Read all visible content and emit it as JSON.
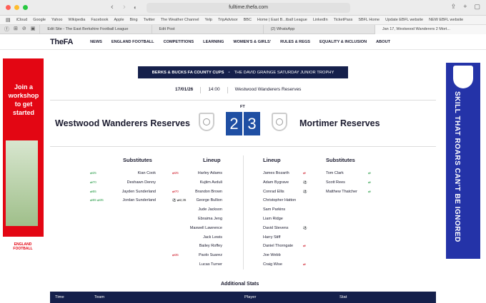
{
  "browser": {
    "url": "fulltime.thefa.com",
    "bookmarks": [
      "iCloud",
      "Google",
      "Yahoo",
      "Wikipedia",
      "Facebook",
      "Apple",
      "Bing",
      "Twitter",
      "The Weather Channel",
      "Yelp",
      "TripAdvisor",
      "BBC",
      "Home | East B...tball League",
      "LinkedIn",
      "TicketPass",
      "SBFL Home",
      "Update EBFL website",
      "NEW EBFL website"
    ],
    "tabs": [
      "Edit Site - The East Berkshire Football League",
      "Edit Post",
      "(2) WhatsApp",
      "Jan 17, Westwood Wanderers 2 Mort..."
    ]
  },
  "fa": {
    "logo": "TheFA",
    "nav": [
      "NEWS",
      "ENGLAND FOOTBALL",
      "COMPETITIONS",
      "LEARNING",
      "WOMEN'S & GIRLS'",
      "RULES & REGS",
      "EQUALITY & INCLUSION",
      "ABOUT"
    ]
  },
  "ads": {
    "left_text": "Join a workshop to get started",
    "left_logo": "ENGLAND FOOTBALL",
    "right_text": "SKILL THAT ROARS CAN'T BE IGNORED"
  },
  "match": {
    "competition": "BERKS & BUCKS FA COUNTY CUPS",
    "trophy": "THE DAVID GRAINGE SATURDAY JUNIOR TROPHY",
    "date": "17/01/26",
    "time": "14:00",
    "venue": "Westwood Wanderers Reserves",
    "status": "FT",
    "home_team": "Westwood Wanderers Reserves",
    "away_team": "Mortimer Reserves",
    "home_score": "2",
    "away_score": "3"
  },
  "headers": {
    "home_subs": "Substitutes",
    "home_lineup": "Lineup",
    "away_lineup": "Lineup",
    "away_subs": "Substitutes"
  },
  "home_subs": [
    {
      "name": "Kian Cook",
      "events": "⇄25"
    },
    {
      "name": "Deshawn Denny",
      "events": "⇄70"
    },
    {
      "name": "Jayden Sunderland",
      "events": "⇄55"
    },
    {
      "name": "Jordan Sunderland",
      "events": "⇄55  ⇄35"
    }
  ],
  "home_lineup": [
    {
      "name": "Harley Adams",
      "events": "⇄25"
    },
    {
      "name": "Kujtim Avduli",
      "events": ""
    },
    {
      "name": "Brandon Brown",
      "events": "⇄70"
    },
    {
      "name": "George Bullion",
      "events": "⚽ ⇄2,35"
    },
    {
      "name": "Jude Jackson",
      "events": ""
    },
    {
      "name": "Ebraima Jeng",
      "events": ""
    },
    {
      "name": "Maxwell Lawrence",
      "events": ""
    },
    {
      "name": "Jack Lewis",
      "events": ""
    },
    {
      "name": "Bailey Roffey",
      "events": ""
    },
    {
      "name": "Paolo Suarez",
      "events": "⇄35"
    },
    {
      "name": "Lucas Turner",
      "events": ""
    }
  ],
  "away_lineup": [
    {
      "name": "James Bozarth",
      "events": "⇄"
    },
    {
      "name": "Adam Bygrave",
      "events": "⚽"
    },
    {
      "name": "Conrad Ellis",
      "events": "⚽"
    },
    {
      "name": "Christopher Hatton",
      "events": ""
    },
    {
      "name": "Sam Parkins",
      "events": ""
    },
    {
      "name": "Liam Ridge",
      "events": ""
    },
    {
      "name": "David Stevens",
      "events": "⚽"
    },
    {
      "name": "Harry Stiff",
      "events": ""
    },
    {
      "name": "Daniel Thorngate",
      "events": "⇄"
    },
    {
      "name": "Joe Webb",
      "events": ""
    },
    {
      "name": "Craig Wise",
      "events": "⇄"
    }
  ],
  "away_subs": [
    {
      "name": "Tom Clark",
      "events": "⇄"
    },
    {
      "name": "Scott Rees",
      "events": "⇄"
    },
    {
      "name": "Matthew Thatcher",
      "events": "⇄"
    }
  ],
  "stats": {
    "title": "Additional Stats",
    "columns": [
      "Time",
      "Team",
      "Player",
      "Stat"
    ]
  }
}
